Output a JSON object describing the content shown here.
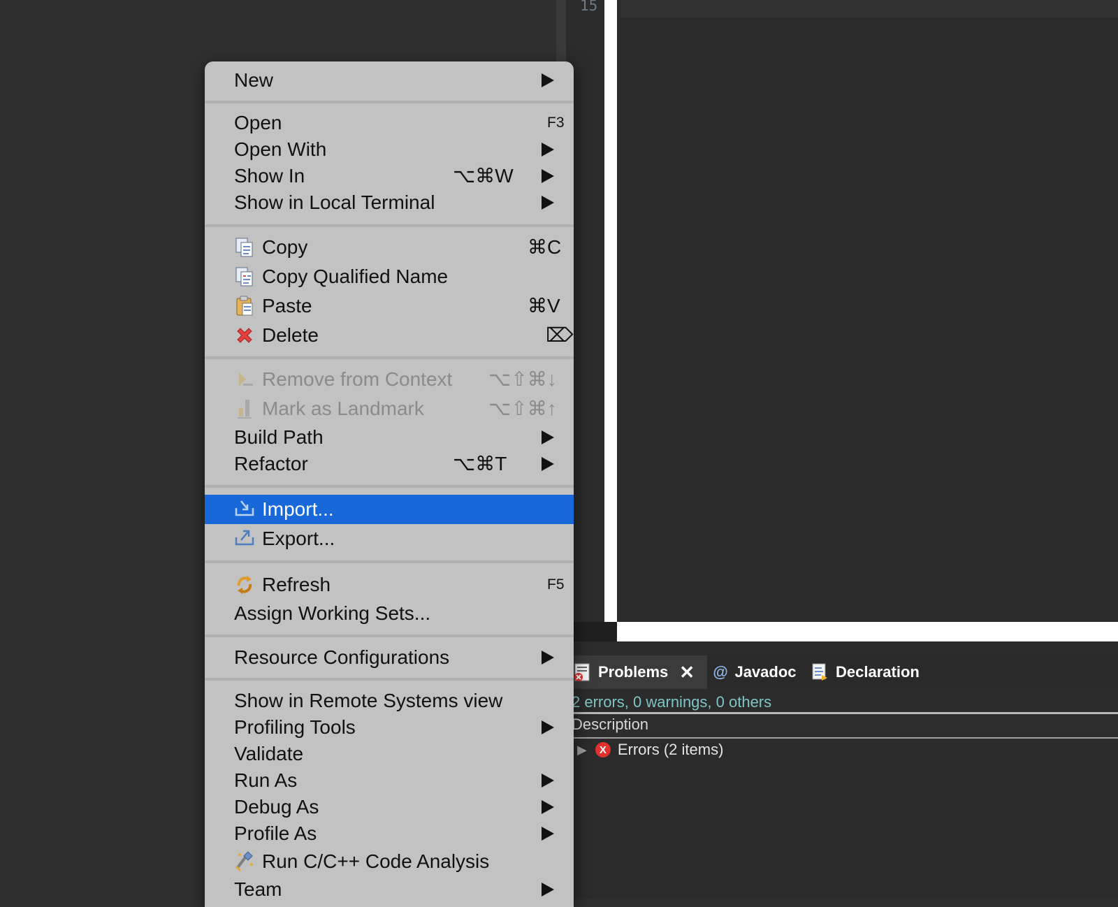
{
  "editor": {
    "line_number": "15"
  },
  "context_menu": {
    "new": "New",
    "open": "Open",
    "open_shortcut": "F3",
    "open_with": "Open With",
    "show_in": "Show In",
    "show_in_shortcut": "⌥⌘W",
    "show_in_local_terminal": "Show in Local Terminal",
    "copy": "Copy",
    "copy_shortcut": "⌘C",
    "copy_qualified_name": "Copy Qualified Name",
    "paste": "Paste",
    "paste_shortcut": "⌘V",
    "delete": "Delete",
    "delete_shortcut": "⌦",
    "remove_from_context": "Remove from Context",
    "remove_from_context_shortcut": "⌥⇧⌘↓",
    "mark_as_landmark": "Mark as Landmark",
    "mark_as_landmark_shortcut": "⌥⇧⌘↑",
    "build_path": "Build Path",
    "refactor": "Refactor",
    "refactor_shortcut": "⌥⌘T",
    "import": "Import...",
    "export": "Export...",
    "refresh": "Refresh",
    "refresh_shortcut": "F5",
    "assign_working_sets": "Assign Working Sets...",
    "resource_configurations": "Resource Configurations",
    "show_in_remote_systems_view": "Show in Remote Systems view",
    "profiling_tools": "Profiling Tools",
    "validate": "Validate",
    "run_as": "Run As",
    "debug_as": "Debug As",
    "profile_as": "Profile As",
    "run_code_analysis": "Run C/C++ Code Analysis",
    "team": "Team"
  },
  "bottom_panel": {
    "tabs": [
      {
        "label": "Problems",
        "icon": "problems-icon",
        "active": true
      },
      {
        "label": "Javadoc",
        "icon": "at-icon",
        "active": false
      },
      {
        "label": "Declaration",
        "icon": "declaration-icon",
        "active": false
      }
    ],
    "close_glyph": "✕",
    "summary": "2 errors, 0 warnings, 0 others",
    "column_header": "Description",
    "error_glyph": "X",
    "error_group": "Errors (2 items)"
  },
  "colors": {
    "menu_background": "#c2c2c2",
    "menu_highlight": "#1868d9",
    "panel_summary_text": "#7fc5c6",
    "error_red": "#e0312f"
  }
}
